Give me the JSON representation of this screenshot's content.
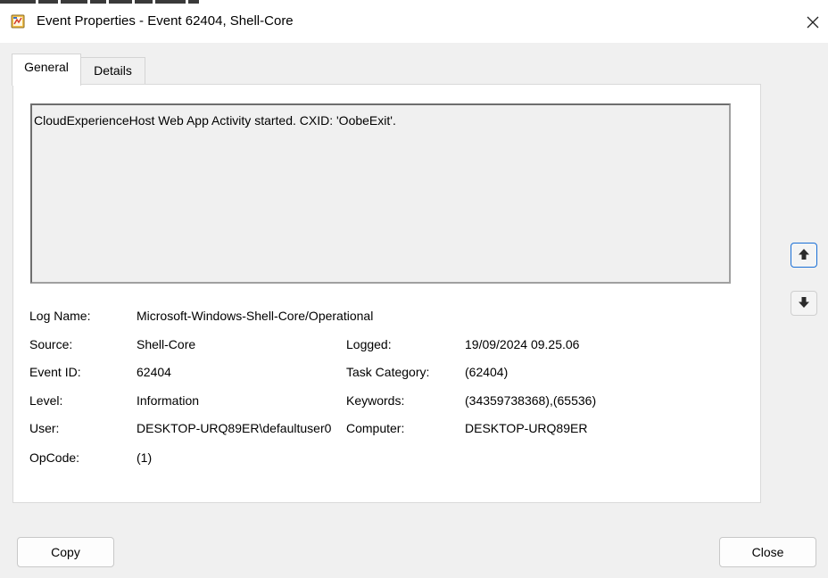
{
  "window": {
    "title": "Event Properties - Event 62404, Shell-Core"
  },
  "tabs": [
    {
      "label": "General",
      "selected": true
    },
    {
      "label": "Details",
      "selected": false
    }
  ],
  "description": "CloudExperienceHost Web App Activity started. CXID: 'OobeExit'.",
  "fields": {
    "log_name": {
      "label": "Log Name:",
      "value": "Microsoft-Windows-Shell-Core/Operational"
    },
    "source": {
      "label": "Source:",
      "value": "Shell-Core"
    },
    "logged": {
      "label": "Logged:",
      "value": "19/09/2024 09.25.06"
    },
    "event_id": {
      "label": "Event ID:",
      "value": "62404"
    },
    "task_category": {
      "label": "Task Category:",
      "value": "(62404)"
    },
    "level": {
      "label": "Level:",
      "value": "Information"
    },
    "keywords": {
      "label": "Keywords:",
      "value": "(34359738368),(65536)"
    },
    "user": {
      "label": "User:",
      "value": "DESKTOP-URQ89ER\\defaultuser0"
    },
    "computer": {
      "label": "Computer:",
      "value": "DESKTOP-URQ89ER"
    },
    "opcode": {
      "label": "OpCode:",
      "value": "(1)"
    }
  },
  "buttons": {
    "copy": "Copy",
    "close": "Close"
  },
  "icons": {
    "app": "event-viewer-icon",
    "close": "close-icon",
    "up": "arrow-up-icon",
    "down": "arrow-down-icon"
  },
  "colors": {
    "focus_border": "#1a6fd6",
    "panel_bg": "#ffffff",
    "window_bg": "#f0f0f0"
  }
}
